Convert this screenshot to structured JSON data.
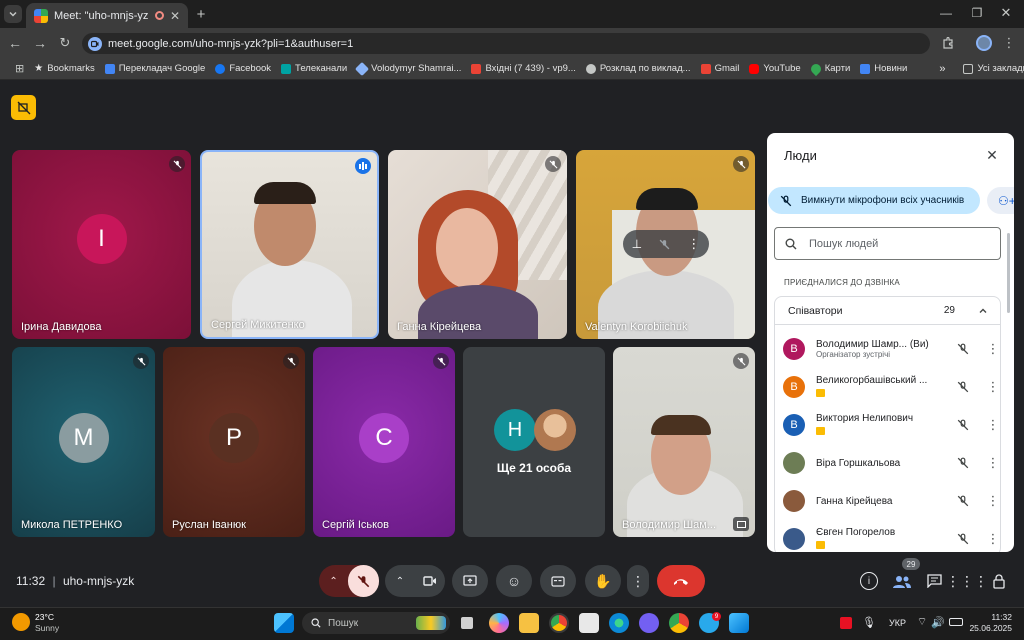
{
  "browser": {
    "tab_title": "Meet: \"uho-mnjs-yzk\"",
    "url": "meet.google.com/uho-mnjs-yzk?pli=1&authuser=1",
    "bookmarks": [
      {
        "label": "Bookmarks",
        "color": "#e3e3e3"
      },
      {
        "label": "Перекладач Google",
        "color": "#4285f4"
      },
      {
        "label": "Facebook",
        "color": "#1877f2"
      },
      {
        "label": "Телеканали",
        "color": "#00a3a3"
      },
      {
        "label": "Volodymyr Shamrai...",
        "color": "#8ab4f8"
      },
      {
        "label": "Вхідні (7 439) - vp9...",
        "color": "#ea4335"
      },
      {
        "label": "Розклад по виклад...",
        "color": "#c4c7c5"
      },
      {
        "label": "Gmail",
        "color": "#ea4335"
      },
      {
        "label": "YouTube",
        "color": "#ff0000"
      },
      {
        "label": "Карти",
        "color": "#34a853"
      },
      {
        "label": "Новини",
        "color": "#4285f4"
      }
    ],
    "all_bookmarks": "Усі закладки"
  },
  "tiles": [
    {
      "name": "Ірина Давидова",
      "initial": "І"
    },
    {
      "name": "Сергей Микитенко"
    },
    {
      "name": "Ганна Кірейцева"
    },
    {
      "name": "Valentyn Korobiichuk"
    },
    {
      "name": "Микола ПЕТРЕНКО",
      "initial": "М"
    },
    {
      "name": "Руслан Іванюк",
      "initial": "Р"
    },
    {
      "name": "Сергій Іськов",
      "initial": "С"
    },
    {
      "name": "Ще 21 особа",
      "initial": "Н"
    },
    {
      "name": "Володимир Шам..."
    }
  ],
  "people_panel": {
    "title": "Люди",
    "mute_all": "Вимкнути мікрофони всіх учасників",
    "search_placeholder": "Пошук людей",
    "section": "ПРИЄДНАЛИСЯ ДО ДЗВІНКА",
    "group": "Співавтори",
    "count": "29",
    "people": [
      {
        "name": "Володимир Шамр...",
        "suffix": "(Ви)",
        "sub": "Організатор зустрічі",
        "initial": "В",
        "color": "#b0185e"
      },
      {
        "name": "Великогорбашівський ...",
        "initial": "В",
        "color": "#e8710a"
      },
      {
        "name": "Виктория Нелипович",
        "initial": "В",
        "color": "#1a5fb4"
      },
      {
        "name": "Віра Горшкальова",
        "initial": "",
        "color": "#6d7d55"
      },
      {
        "name": "Ганна Кірейцева",
        "initial": "",
        "color": "#8a5a3c"
      },
      {
        "name": "Євген Погорелов",
        "initial": "",
        "color": "#3a5a8a"
      }
    ]
  },
  "controls": {
    "time": "11:32",
    "meeting_code": "uho-mnjs-yzk",
    "participants_badge": "29"
  },
  "taskbar": {
    "temp": "23°C",
    "weather": "Sunny",
    "search": "Пошук",
    "lang": "УКР",
    "clock_time": "11:32",
    "clock_date": "25.06.2025"
  }
}
